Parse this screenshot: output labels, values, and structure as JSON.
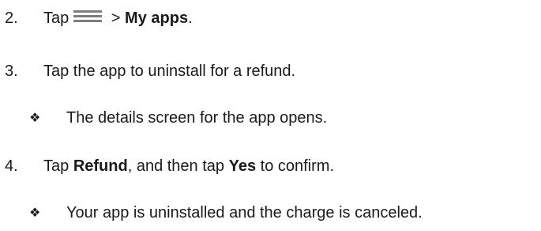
{
  "steps": [
    {
      "number": "2.",
      "prefix": "Tap",
      "icon": "menu-icon",
      "connector": " > ",
      "bold": "My apps",
      "suffix": "."
    },
    {
      "number": "3.",
      "text": "Tap the app to uninstall for a refund."
    },
    {
      "number": "4.",
      "prefix": "Tap ",
      "bold1": "Refund",
      "middle": ", and then tap ",
      "bold2": "Yes",
      "suffix": " to confirm."
    }
  ],
  "results": [
    {
      "bullet": "❖",
      "text": "The details screen for the app opens."
    },
    {
      "bullet": "❖",
      "text": "Your app is uninstalled and the charge is canceled."
    }
  ],
  "colors": {
    "text": "#1a1a1a",
    "icon": "#7d7d7d",
    "background": "#ffffff"
  }
}
